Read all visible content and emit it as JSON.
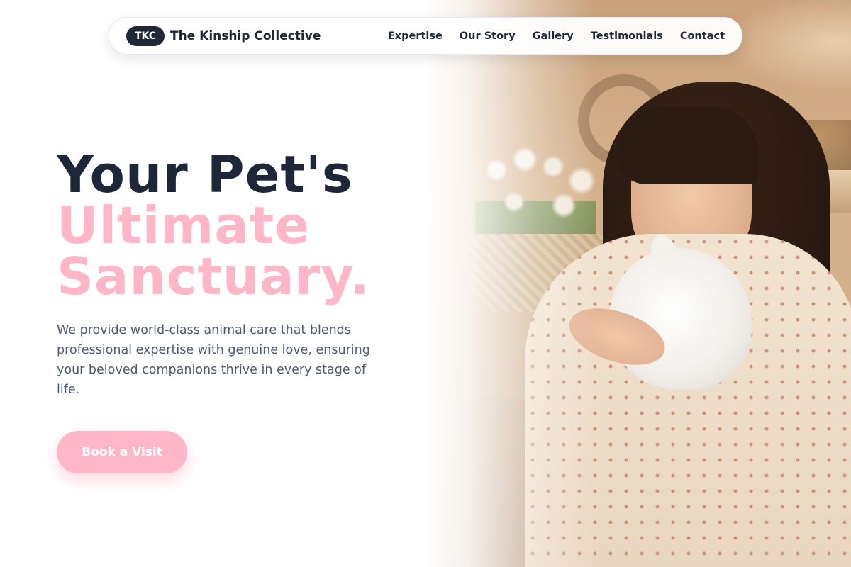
{
  "nav": {
    "logo_badge": "TKC",
    "brand": "The Kinship Collective",
    "links": [
      "Expertise",
      "Our Story",
      "Gallery",
      "Testimonials",
      "Contact"
    ]
  },
  "hero": {
    "title_line1": "Your Pet's",
    "title_line2": "Ultimate",
    "title_line3": "Sanctuary.",
    "description": "We provide world-class animal care that blends professional expertise with genuine love, ensuring your beloved companions thrive in every stage of life.",
    "cta_label": "Book a Visit"
  },
  "colors": {
    "navy": "#1e2638",
    "pink": "#ffb6c8",
    "body_text": "#4f5a6a"
  }
}
